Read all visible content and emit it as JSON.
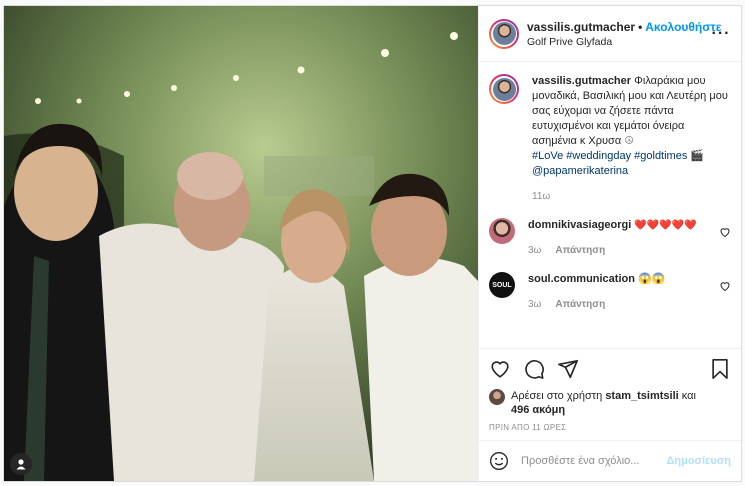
{
  "header": {
    "username": "vassilis.gutmacher",
    "separator": "•",
    "follow_label": "Ακολουθήστε",
    "location": "Golf Prive Glyfada",
    "more_icon": "more-horizontal-icon"
  },
  "caption": {
    "username": "vassilis.gutmacher",
    "text": "Φιλαράκια μου μοναδικά, Βασιλική μου και Λευτέρη μου σας εύχομαι να ζήσετε πάντα ευτυχισμένοι και γεμάτοι όνειρα ασημένια κ Χρυσα",
    "emoji": "☮",
    "hashtags": "#LoVe #weddingday #goldtimes",
    "emoji2": "🎬",
    "mention": "@papamerikaterina",
    "time": "11ω"
  },
  "comments": [
    {
      "username": "domnikivasiageorgi",
      "text": "❤️❤️❤️❤️❤️",
      "time": "3ω",
      "reply_label": "Απάντηση"
    },
    {
      "username": "soul.communication",
      "text": "😱😱",
      "avatar_text": "SOUL",
      "time": "3ω",
      "reply_label": "Απάντηση"
    }
  ],
  "likes": {
    "prefix": "Αρέσει στο χρήστη",
    "user": "stam_tsimtsili",
    "connector": "και",
    "count": "496 ακόμη"
  },
  "timestamp": "ΠΡΙΝ ΑΠΟ 11 ΩΡΕΣ",
  "add_comment": {
    "placeholder": "Προσθέστε ένα σχόλιο...",
    "post_label": "Δημοσίευση"
  },
  "colors": {
    "link": "#0095f6",
    "hashtag": "#00376b",
    "muted": "#8e8e8e",
    "heart": "#ed4956"
  }
}
